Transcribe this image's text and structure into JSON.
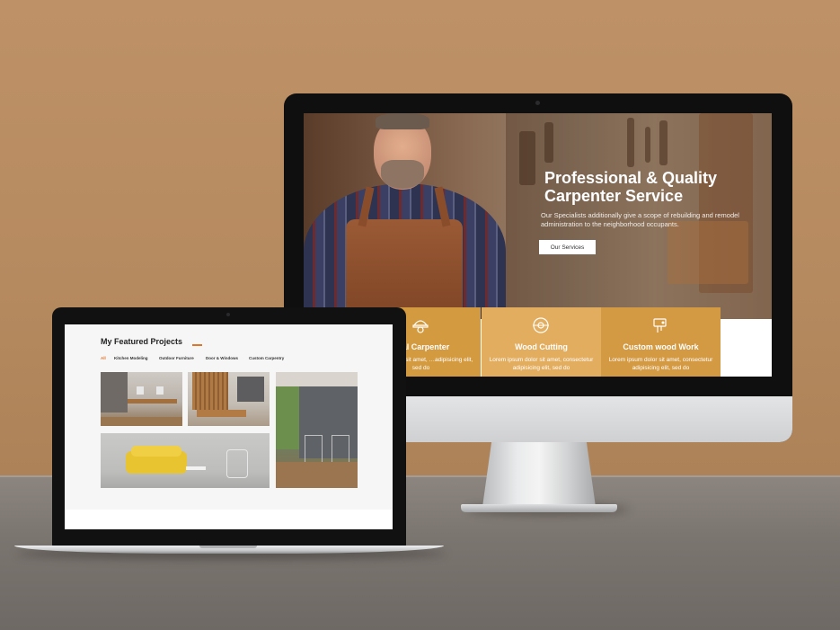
{
  "colors": {
    "accent_orange": "#e0752a",
    "service_gold_1": "#d39a3f",
    "service_gold_2": "#e3ad5f",
    "service_gold_3": "#d49a43",
    "wall": "#b98c60",
    "desk": "#7b7570"
  },
  "hero": {
    "title_line1": "Professional & Quality",
    "title_line2": "Carpenter Service",
    "subtitle": "Our Specialists additionally give a scope of rebuilding and remodel administration to the neighborhood occupants.",
    "button_label": "Our Services"
  },
  "services": [
    {
      "title": "onal Carpenter",
      "text": "…psum dolor sit amet, …adipisicing elit, sed do",
      "icon": "worker-helmet-icon"
    },
    {
      "title": "Wood Cutting",
      "text": "Lorem ipsum dolor sit amet, consectetur adipisicing elit, sed do",
      "icon": "circular-saw-icon"
    },
    {
      "title": "Custom wood Work",
      "text": "Lorem ipsum dolor sit amet, consectetur adipisicing elit, sed do",
      "icon": "jigsaw-icon"
    }
  ],
  "projects": {
    "title": "My Featured Projects",
    "filters": [
      "All",
      "Kitchen Modeling",
      "Outdoor Furniture",
      "Door & Windows",
      "Custom Carpentry"
    ],
    "active_filter": "All",
    "tiles": [
      {
        "subject": "office-workspace",
        "icon": "office-photo"
      },
      {
        "subject": "wood-panel-lounge",
        "icon": "lounge-photo"
      },
      {
        "subject": "patio-chairs",
        "icon": "patio-photo"
      },
      {
        "subject": "yellow-sofa-room",
        "icon": "sofa-photo"
      }
    ]
  }
}
